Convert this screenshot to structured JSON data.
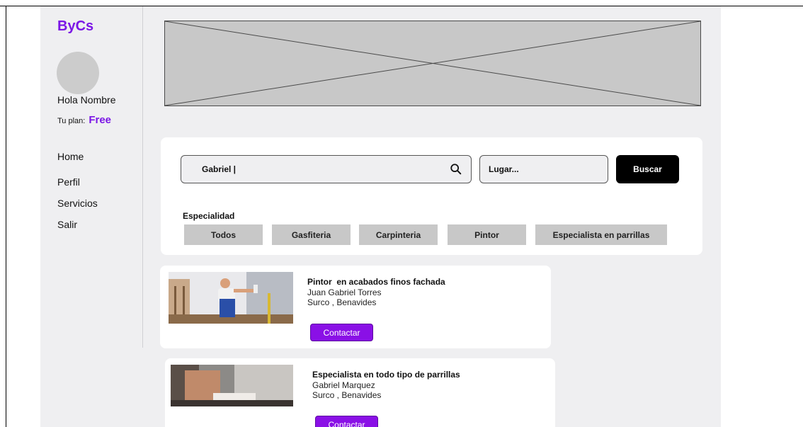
{
  "sidebar": {
    "logo": "ByCs",
    "greeting": "Hola Nombre",
    "plan_label": "Tu plan:",
    "plan_value": "Free",
    "nav": [
      {
        "label": "Home"
      },
      {
        "label": "Perfil"
      },
      {
        "label": "Servicios"
      },
      {
        "label": "Salir"
      }
    ]
  },
  "search": {
    "query_value": "Gabriel |",
    "location_placeholder": "Lugar...",
    "button_label": "Buscar",
    "icon": "search-icon"
  },
  "specialty": {
    "label": "Especialidad",
    "chips": [
      {
        "label": "Todos"
      },
      {
        "label": "Gasfiteria"
      },
      {
        "label": "Carpinteria"
      },
      {
        "label": "Pintor"
      },
      {
        "label": "Especialista en parrillas"
      }
    ]
  },
  "results": [
    {
      "title": "Pintor  en acabados finos fachada",
      "name": "Juan Gabriel Torres",
      "location": "Surco , Benavides",
      "button_label": "Contactar"
    },
    {
      "title": "Especialista en todo tipo de parrillas",
      "name": "Gabriel Marquez",
      "location": "Surco , Benavides",
      "button_label": "Contactar"
    }
  ],
  "colors": {
    "brand": "#7b16e6",
    "contact_button": "#8a10e6",
    "search_button": "#000000",
    "chip_bg": "#c8c8c8",
    "app_bg": "#efeff1"
  }
}
